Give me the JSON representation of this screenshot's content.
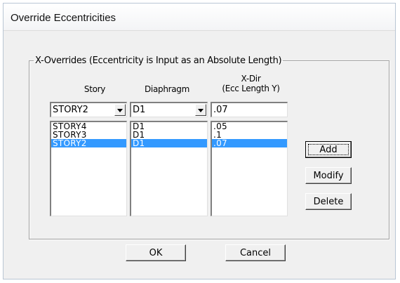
{
  "window": {
    "title": "Override Eccentricities"
  },
  "group": {
    "legend": "X-Overrides  (Eccentricity is Input as an Absolute Length)"
  },
  "columns": {
    "story": "Story",
    "diaphragm": "Diaphragm",
    "xdir_line1": "X-Dir",
    "xdir_line2": "(Ecc Length Y)"
  },
  "inputs": {
    "story": "STORY2",
    "diaphragm": "D1",
    "ecc": ".07"
  },
  "lists": {
    "story": [
      "STORY4",
      "STORY3",
      "STORY2"
    ],
    "diaphragm": [
      "D1",
      "D1",
      "D1"
    ],
    "ecc": [
      ".05",
      ".1",
      ".07"
    ],
    "selected_index": 2
  },
  "buttons": {
    "add": "Add",
    "modify": "Modify",
    "delete": "Delete",
    "ok": "OK",
    "cancel": "Cancel"
  },
  "icons": {
    "dropdown": "chevron-down-icon"
  },
  "colors": {
    "selection": "#3399ff",
    "dialog_bg": "#f0f0f0"
  }
}
